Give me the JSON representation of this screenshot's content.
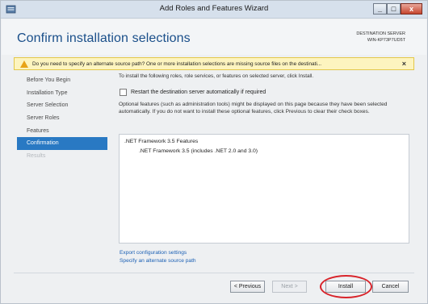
{
  "window": {
    "title": "Add Roles and Features Wizard",
    "minimize_glyph": "_",
    "maximize_glyph": "□",
    "close_glyph": "x"
  },
  "header": {
    "title": "Confirm installation selections",
    "destination_label": "DESTINATION SERVER",
    "destination_name": "WIN-KP73P7UD5T"
  },
  "warning": {
    "text": "Do you need to specify an alternate source path? One or more installation selections are missing source files on the destinati...",
    "close_glyph": "×"
  },
  "nav": {
    "items": [
      {
        "label": "Before You Begin",
        "state": "normal"
      },
      {
        "label": "Installation Type",
        "state": "normal"
      },
      {
        "label": "Server Selection",
        "state": "normal"
      },
      {
        "label": "Server Roles",
        "state": "normal"
      },
      {
        "label": "Features",
        "state": "normal"
      },
      {
        "label": "Confirmation",
        "state": "active"
      },
      {
        "label": "Results",
        "state": "disabled"
      }
    ]
  },
  "content": {
    "intro": "To install the following roles, role services, or features on selected server, click Install.",
    "restart_checkbox_label": "Restart the destination server automatically if required",
    "restart_checked": false,
    "optional_note": "Optional features (such as administration tools) might be displayed on this page because they have been selected automatically. If you do not want to install these optional features, click Previous to clear their check boxes.",
    "features": [
      {
        "label": ".NET Framework 3.5 Features",
        "level": 0
      },
      {
        "label": ".NET Framework 3.5 (includes .NET 2.0 and 3.0)",
        "level": 1
      }
    ],
    "export_link": "Export configuration settings",
    "alternate_source_link": "Specify an alternate source path"
  },
  "buttons": {
    "previous": "< Previous",
    "next": "Next >",
    "install": "Install",
    "cancel": "Cancel"
  },
  "colors": {
    "accent": "#2979c3",
    "title": "#1a4f8a",
    "warning_bg": "#fdf4bf",
    "highlight": "#d8232a"
  }
}
